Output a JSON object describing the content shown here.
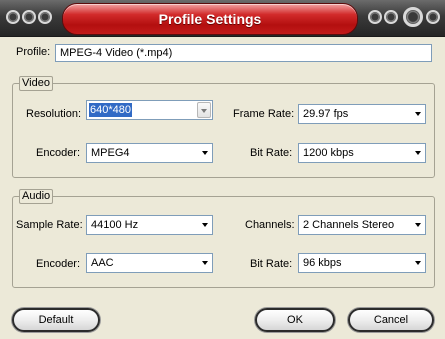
{
  "window": {
    "title": "Profile Settings"
  },
  "profile": {
    "label": "Profile:",
    "value": "MPEG-4 Video (*.mp4)"
  },
  "video": {
    "group_label": "Video",
    "resolution": {
      "label": "Resolution:",
      "value": "640*480"
    },
    "frame_rate": {
      "label": "Frame Rate:",
      "value": "29.97 fps"
    },
    "encoder": {
      "label": "Encoder:",
      "value": "MPEG4"
    },
    "bit_rate": {
      "label": "Bit Rate:",
      "value": "1200 kbps"
    }
  },
  "audio": {
    "group_label": "Audio",
    "sample_rate": {
      "label": "Sample Rate:",
      "value": "44100 Hz"
    },
    "channels": {
      "label": "Channels:",
      "value": "2 Channels Stereo"
    },
    "encoder": {
      "label": "Encoder:",
      "value": "AAC"
    },
    "bit_rate": {
      "label": "Bit Rate:",
      "value": "96 kbps"
    }
  },
  "buttons": {
    "default": "Default",
    "ok": "OK",
    "cancel": "Cancel"
  },
  "colors": {
    "title_accent": "#c21b1b",
    "titlebar_bg": "#333333",
    "dialog_bg": "#ece9d8"
  },
  "icons": [
    "ring-icon",
    "dropdown-arrow-icon"
  ]
}
